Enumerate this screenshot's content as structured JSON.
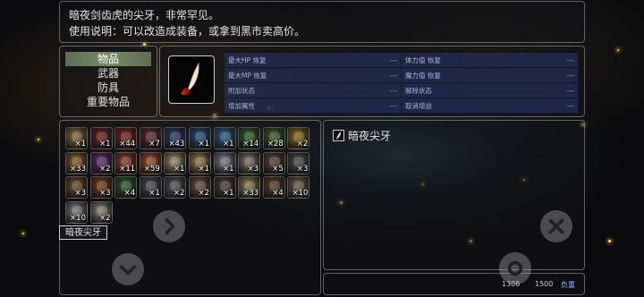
{
  "help": {
    "line1": "暗夜剑齿虎的尖牙，非常罕见。",
    "line2": "使用说明：可以改造成装备，或拿到黑市卖高价。"
  },
  "categories": [
    {
      "label": "物品",
      "selected": true
    },
    {
      "label": "武器",
      "selected": false
    },
    {
      "label": "防具",
      "selected": false
    },
    {
      "label": "重要物品",
      "selected": false
    }
  ],
  "stats": [
    [
      {
        "label": "最大HP 恢复",
        "value": "---"
      },
      {
        "label": "体力值 恢复",
        "value": "---"
      }
    ],
    [
      {
        "label": "最大MP 恢复",
        "value": "---"
      },
      {
        "label": "魔力值 恢复",
        "value": "---"
      }
    ],
    [
      {
        "label": "附加状态",
        "value": "---"
      },
      {
        "label": "解除状态",
        "value": "---"
      }
    ],
    [
      {
        "label": "增加属性",
        "value": "---"
      },
      {
        "label": "取消增益",
        "value": "---"
      }
    ]
  ],
  "inventory": [
    {
      "icon": "scroll-icon",
      "count": "×1",
      "color": "#8a6a3a"
    },
    {
      "icon": "red-potion-icon",
      "count": "×1",
      "color": "#6a1f1f"
    },
    {
      "icon": "red-potion-icon",
      "count": "×44",
      "color": "#7a2020"
    },
    {
      "icon": "red-potion-icon",
      "count": "×7",
      "color": "#5a2a2a"
    },
    {
      "icon": "blue-potion-icon",
      "count": "×43",
      "color": "#2a3a6a"
    },
    {
      "icon": "blue-potion-icon",
      "count": "×1",
      "color": "#2a4a7a"
    },
    {
      "icon": "blue-potion-icon",
      "count": "×1",
      "color": "#2a5a8a"
    },
    {
      "icon": "herb-icon",
      "count": "×14",
      "color": "#2f5a2a"
    },
    {
      "icon": "herb-icon",
      "count": "×28",
      "color": "#3a5a2a"
    },
    {
      "icon": "gold-orb-icon",
      "count": "×2",
      "color": "#8a6a1a"
    },
    {
      "icon": "bread-icon",
      "count": "×33",
      "color": "#8a5a2a"
    },
    {
      "icon": "grape-icon",
      "count": "×2",
      "color": "#5a2a6a"
    },
    {
      "icon": "meat-icon",
      "count": "×11",
      "color": "#8a3a2a"
    },
    {
      "icon": "meat-icon",
      "count": "×59",
      "color": "#9a4a2a"
    },
    {
      "icon": "egg-icon",
      "count": "×1",
      "color": "#9a8a6a"
    },
    {
      "icon": "cookie-icon",
      "count": "×1",
      "color": "#9a7a4a"
    },
    {
      "icon": "cup-icon",
      "count": "×1",
      "color": "#7a7a8a"
    },
    {
      "icon": "rice-icon",
      "count": "×3",
      "color": "#7a7060"
    },
    {
      "icon": "stick-icon",
      "count": "×5",
      "color": "#5a4030"
    },
    {
      "icon": "mushroom-icon",
      "count": "×3",
      "color": "#4a4a4a"
    },
    {
      "icon": "wood-icon",
      "count": "×3",
      "color": "#6a4a2a"
    },
    {
      "icon": "torch-icon",
      "count": "×3",
      "color": "#7a3a1a"
    },
    {
      "icon": "cucumber-icon",
      "count": "×4",
      "color": "#2a5a2a"
    },
    {
      "icon": "ore-icon",
      "count": "×1",
      "color": "#4a4a50"
    },
    {
      "icon": "ore-icon",
      "count": "×2",
      "color": "#505058"
    },
    {
      "icon": "bone-icon",
      "count": "×2",
      "color": "#6a4a3a"
    },
    {
      "icon": "leather-icon",
      "count": "×1",
      "color": "#4a3a2a"
    },
    {
      "icon": "claw-icon",
      "count": "×33",
      "color": "#8a7a4a"
    },
    {
      "icon": "horn-icon",
      "count": "×4",
      "color": "#5a3a2a"
    },
    {
      "icon": "hide-icon",
      "count": "×10",
      "color": "#6a5a4a"
    },
    {
      "icon": "feather-icon",
      "count": "×10",
      "color": "#7a7a7a"
    },
    {
      "icon": "fang-icon",
      "count": "×2",
      "color": "#8a8070"
    }
  ],
  "tooltip": "暗夜尖牙",
  "detail": {
    "name": "暗夜尖牙"
  },
  "weight": {
    "current": "1306",
    "max": "1500",
    "label": "负重"
  },
  "colors": {
    "panel_border": "#c8c8c8",
    "category_selected": "#7a8a6a",
    "stat_cell": "#283770"
  }
}
